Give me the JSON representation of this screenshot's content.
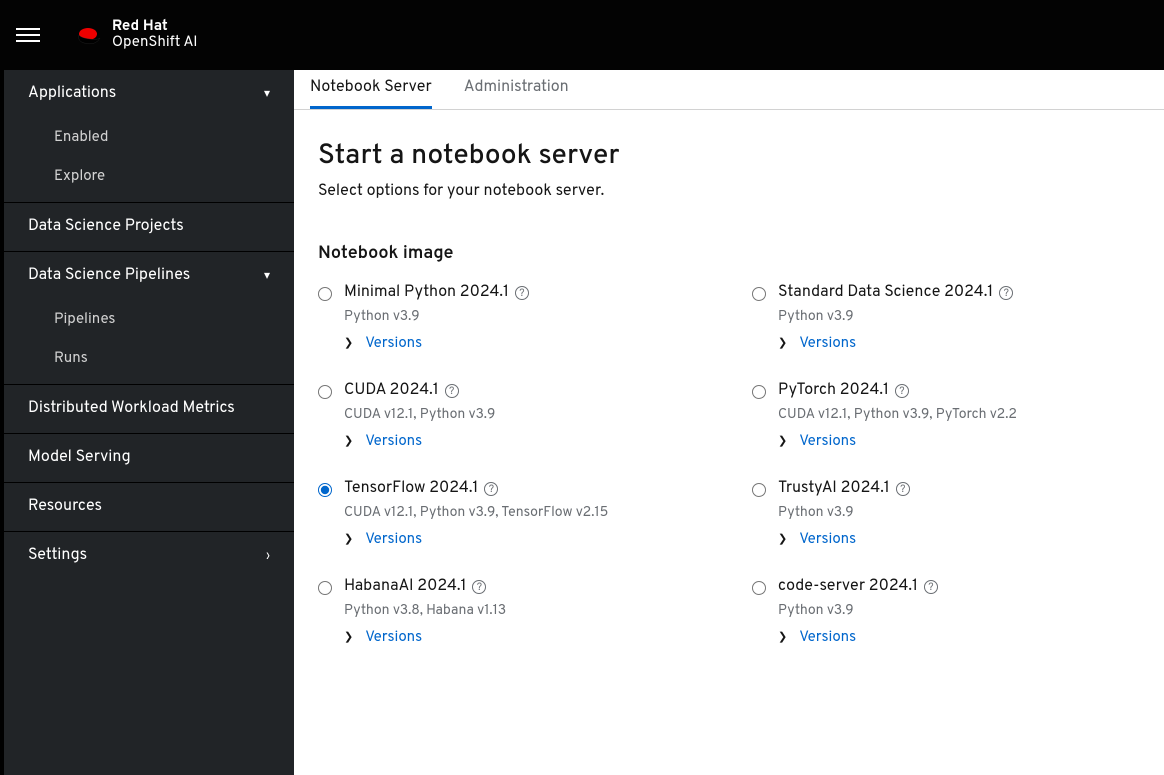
{
  "brand": {
    "line1": "Red Hat",
    "line2": "OpenShift AI"
  },
  "sidebar": {
    "applications": {
      "label": "Applications",
      "enabled": "Enabled",
      "explore": "Explore"
    },
    "dsp": "Data Science Projects",
    "pipelines": {
      "label": "Data Science Pipelines",
      "pipelines": "Pipelines",
      "runs": "Runs"
    },
    "dwm": "Distributed Workload Metrics",
    "serving": "Model Serving",
    "resources": "Resources",
    "settings": "Settings"
  },
  "tabs": {
    "notebook": "Notebook Server",
    "admin": "Administration"
  },
  "page": {
    "title": "Start a notebook server",
    "subtitle": "Select options for your notebook server.",
    "section": "Notebook image",
    "versions": "Versions"
  },
  "images": [
    {
      "name": "Minimal Python 2024.1",
      "desc": "Python v3.9",
      "selected": false
    },
    {
      "name": "Standard Data Science 2024.1",
      "desc": "Python v3.9",
      "selected": false
    },
    {
      "name": "CUDA 2024.1",
      "desc": "CUDA v12.1, Python v3.9",
      "selected": false
    },
    {
      "name": "PyTorch 2024.1",
      "desc": "CUDA v12.1, Python v3.9, PyTorch v2.2",
      "selected": false
    },
    {
      "name": "TensorFlow 2024.1",
      "desc": "CUDA v12.1, Python v3.9, TensorFlow v2.15",
      "selected": true
    },
    {
      "name": "TrustyAI 2024.1",
      "desc": "Python v3.9",
      "selected": false
    },
    {
      "name": "HabanaAI 2024.1",
      "desc": "Python v3.8, Habana v1.13",
      "selected": false
    },
    {
      "name": "code-server 2024.1",
      "desc": "Python v3.9",
      "selected": false
    }
  ]
}
